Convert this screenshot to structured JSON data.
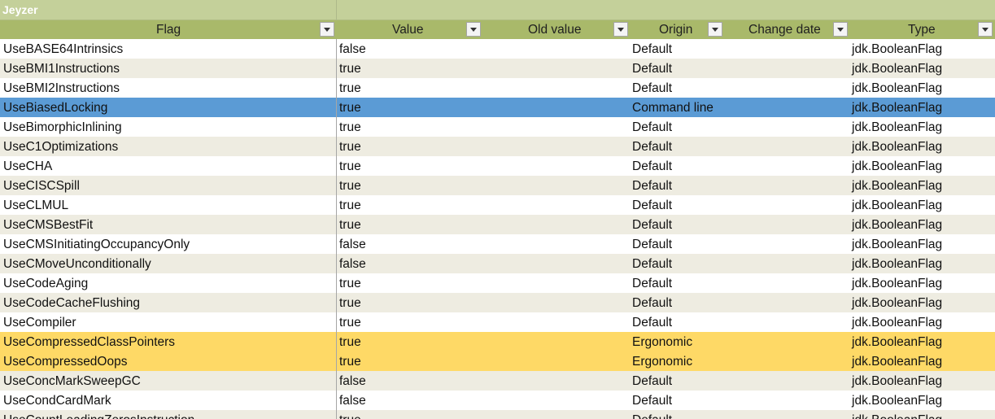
{
  "sheet_title": "Jeyzer",
  "columns": [
    {
      "key": "flag",
      "label": "Flag"
    },
    {
      "key": "value",
      "label": "Value"
    },
    {
      "key": "old_value",
      "label": "Old value"
    },
    {
      "key": "origin",
      "label": "Origin"
    },
    {
      "key": "change_date",
      "label": "Change date"
    },
    {
      "key": "type",
      "label": "Type"
    }
  ],
  "colors": {
    "title_bg": "#c4d09a",
    "header_bg": "#a9b96a",
    "band_light": "#ffffff",
    "band_dark": "#eeece1",
    "selected_bg": "#5b9bd5",
    "ergonomic_bg": "#fed966"
  },
  "rows": [
    {
      "flag": "UseBASE64Intrinsics",
      "value": "false",
      "old_value": "",
      "origin": "Default",
      "change_date": "",
      "type": "jdk.BooleanFlag",
      "state": "normal"
    },
    {
      "flag": "UseBMI1Instructions",
      "value": "true",
      "old_value": "",
      "origin": "Default",
      "change_date": "",
      "type": "jdk.BooleanFlag",
      "state": "normal"
    },
    {
      "flag": "UseBMI2Instructions",
      "value": "true",
      "old_value": "",
      "origin": "Default",
      "change_date": "",
      "type": "jdk.BooleanFlag",
      "state": "normal"
    },
    {
      "flag": "UseBiasedLocking",
      "value": "true",
      "old_value": "",
      "origin": "Command line",
      "change_date": "",
      "type": "jdk.BooleanFlag",
      "state": "selected"
    },
    {
      "flag": "UseBimorphicInlining",
      "value": "true",
      "old_value": "",
      "origin": "Default",
      "change_date": "",
      "type": "jdk.BooleanFlag",
      "state": "normal"
    },
    {
      "flag": "UseC1Optimizations",
      "value": "true",
      "old_value": "",
      "origin": "Default",
      "change_date": "",
      "type": "jdk.BooleanFlag",
      "state": "normal"
    },
    {
      "flag": "UseCHA",
      "value": "true",
      "old_value": "",
      "origin": "Default",
      "change_date": "",
      "type": "jdk.BooleanFlag",
      "state": "normal"
    },
    {
      "flag": "UseCISCSpill",
      "value": "true",
      "old_value": "",
      "origin": "Default",
      "change_date": "",
      "type": "jdk.BooleanFlag",
      "state": "normal"
    },
    {
      "flag": "UseCLMUL",
      "value": "true",
      "old_value": "",
      "origin": "Default",
      "change_date": "",
      "type": "jdk.BooleanFlag",
      "state": "normal"
    },
    {
      "flag": "UseCMSBestFit",
      "value": "true",
      "old_value": "",
      "origin": "Default",
      "change_date": "",
      "type": "jdk.BooleanFlag",
      "state": "normal"
    },
    {
      "flag": "UseCMSInitiatingOccupancyOnly",
      "value": "false",
      "old_value": "",
      "origin": "Default",
      "change_date": "",
      "type": "jdk.BooleanFlag",
      "state": "normal"
    },
    {
      "flag": "UseCMoveUnconditionally",
      "value": "false",
      "old_value": "",
      "origin": "Default",
      "change_date": "",
      "type": "jdk.BooleanFlag",
      "state": "normal"
    },
    {
      "flag": "UseCodeAging",
      "value": "true",
      "old_value": "",
      "origin": "Default",
      "change_date": "",
      "type": "jdk.BooleanFlag",
      "state": "normal"
    },
    {
      "flag": "UseCodeCacheFlushing",
      "value": "true",
      "old_value": "",
      "origin": "Default",
      "change_date": "",
      "type": "jdk.BooleanFlag",
      "state": "normal"
    },
    {
      "flag": "UseCompiler",
      "value": "true",
      "old_value": "",
      "origin": "Default",
      "change_date": "",
      "type": "jdk.BooleanFlag",
      "state": "normal"
    },
    {
      "flag": "UseCompressedClassPointers",
      "value": "true",
      "old_value": "",
      "origin": "Ergonomic",
      "change_date": "",
      "type": "jdk.BooleanFlag",
      "state": "ergonomic"
    },
    {
      "flag": "UseCompressedOops",
      "value": "true",
      "old_value": "",
      "origin": "Ergonomic",
      "change_date": "",
      "type": "jdk.BooleanFlag",
      "state": "ergonomic"
    },
    {
      "flag": "UseConcMarkSweepGC",
      "value": "false",
      "old_value": "",
      "origin": "Default",
      "change_date": "",
      "type": "jdk.BooleanFlag",
      "state": "normal"
    },
    {
      "flag": "UseCondCardMark",
      "value": "false",
      "old_value": "",
      "origin": "Default",
      "change_date": "",
      "type": "jdk.BooleanFlag",
      "state": "normal"
    },
    {
      "flag": "UseCountLeadingZerosInstruction",
      "value": "true",
      "old_value": "",
      "origin": "Default",
      "change_date": "",
      "type": "jdk.BooleanFlag",
      "state": "normal"
    }
  ]
}
